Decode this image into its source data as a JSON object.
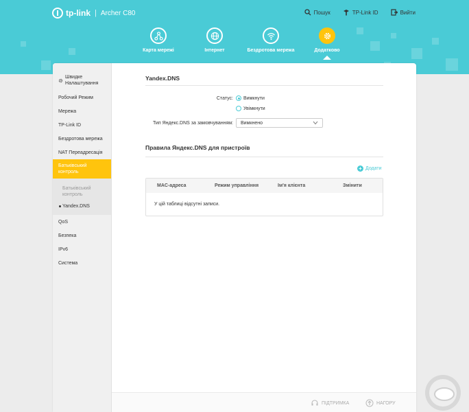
{
  "header": {
    "brand": "tp-link",
    "separator": "|",
    "model": "Archer C80",
    "top_links": [
      {
        "label": "Пошук",
        "icon": "search-icon"
      },
      {
        "label": "TP-Link ID",
        "icon": "tplink-id-icon"
      },
      {
        "label": "Вийти",
        "icon": "logout-icon"
      }
    ],
    "nav": [
      {
        "label": "Карта мережі",
        "icon": "network-map-icon"
      },
      {
        "label": "Інтернет",
        "icon": "globe-icon"
      },
      {
        "label": "Бездротова мережа",
        "icon": "wifi-icon"
      },
      {
        "label": "Додатково",
        "icon": "gear-icon",
        "active": true
      }
    ]
  },
  "sidebar": {
    "items": [
      {
        "label": "Швидке Налаштування"
      },
      {
        "label": "Робочий Режим"
      },
      {
        "label": "Мережа"
      },
      {
        "label": "TP-Link ID"
      },
      {
        "label": "Бездротова мережа"
      },
      {
        "label": "NAT Переадресація"
      },
      {
        "label": "Батьківський контроль"
      },
      {
        "label": "QoS"
      },
      {
        "label": "Безпека"
      },
      {
        "label": "IPv6"
      },
      {
        "label": "Система"
      }
    ],
    "subitems": [
      {
        "label": "Батьківський контроль"
      },
      {
        "label": "Yandex.DNS"
      }
    ]
  },
  "main": {
    "section1_title": "Yandex.DNS",
    "status_label": "Статус:",
    "status_options": [
      "Вимкнути",
      "Увімкнути"
    ],
    "status_selected": "Вимкнути",
    "default_type_label": "Тип Яндекс.DNS за замовчуванням:",
    "default_type_value": "Вимкнено",
    "section2_title": "Правила Яндекс.DNS для пристроїв",
    "add_label": "Додати",
    "table": {
      "columns": [
        "MAC-адреса",
        "Режим управління",
        "Ім'я клієнта",
        "Змінити"
      ],
      "empty_text": "У цій таблиці відсутні записи."
    }
  },
  "footer": {
    "support": "ПІДТРИМКА",
    "top": "НАГОРУ"
  },
  "colors": {
    "header_bg": "#4acbd6",
    "accent": "#ffc40d",
    "link": "#4acbd6"
  }
}
